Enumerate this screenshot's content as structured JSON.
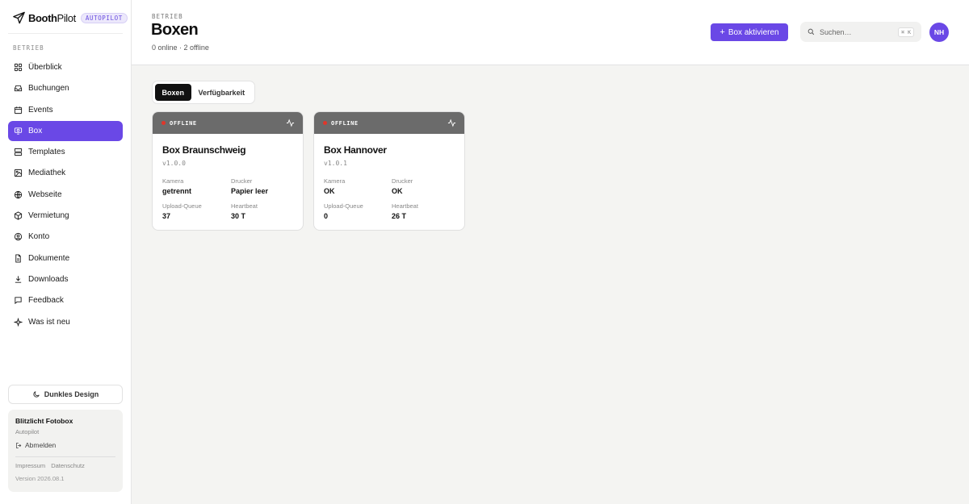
{
  "brand": {
    "name_bold": "Booth",
    "name_thin": "Pilot",
    "tag": "AUTOPILOT"
  },
  "sidebar": {
    "section": "BETRIEB",
    "items": [
      {
        "label": "Überblick",
        "icon": "grid-icon"
      },
      {
        "label": "Buchungen",
        "icon": "inbox-icon"
      },
      {
        "label": "Events",
        "icon": "calendar-icon"
      },
      {
        "label": "Box",
        "icon": "box-device-icon",
        "active": true
      },
      {
        "label": "Templates",
        "icon": "layers-icon"
      },
      {
        "label": "Mediathek",
        "icon": "image-icon"
      },
      {
        "label": "Webseite",
        "icon": "globe-icon"
      },
      {
        "label": "Vermietung",
        "icon": "package-icon"
      },
      {
        "label": "Konto",
        "icon": "user-circle-icon"
      },
      {
        "label": "Dokumente",
        "icon": "file-icon"
      },
      {
        "label": "Downloads",
        "icon": "download-icon"
      },
      {
        "label": "Feedback",
        "icon": "message-icon"
      },
      {
        "label": "Was ist neu",
        "icon": "sparkle-icon"
      }
    ],
    "dark_mode_label": "Dunkles Design",
    "account": {
      "org": "Blitzlicht Fotobox",
      "plan": "Autopilot",
      "logout": "Abmelden",
      "links": [
        "Impressum",
        "Datenschutz"
      ],
      "version": "Version 2026.08.1"
    }
  },
  "header": {
    "crumb": "BETRIEB",
    "title": "Boxen",
    "subtitle": "0 online · 2 offline",
    "activate_label": "Box aktivieren",
    "search_placeholder": "Suchen…",
    "search_shortcut": "⌘ K",
    "avatar_initials": "NH"
  },
  "tabs": [
    {
      "label": "Boxen",
      "active": true
    },
    {
      "label": "Verfügbarkeit",
      "active": false
    }
  ],
  "boxes": [
    {
      "status": "OFFLINE",
      "name": "Box Braunschweig",
      "version": "v1.0.0",
      "fields": [
        {
          "label": "Kamera",
          "value": "getrennt"
        },
        {
          "label": "Drucker",
          "value": "Papier leer"
        },
        {
          "label": "Upload-Queue",
          "value": "37"
        },
        {
          "label": "Heartbeat",
          "value": "30 T"
        }
      ]
    },
    {
      "status": "OFFLINE",
      "name": "Box Hannover",
      "version": "v1.0.1",
      "fields": [
        {
          "label": "Kamera",
          "value": "OK"
        },
        {
          "label": "Drucker",
          "value": "OK"
        },
        {
          "label": "Upload-Queue",
          "value": "0"
        },
        {
          "label": "Heartbeat",
          "value": "26 T"
        }
      ]
    }
  ],
  "colors": {
    "accent": "#6a48e6",
    "offline_dot": "#e0362b",
    "status_bar": "#6b6b6b"
  }
}
